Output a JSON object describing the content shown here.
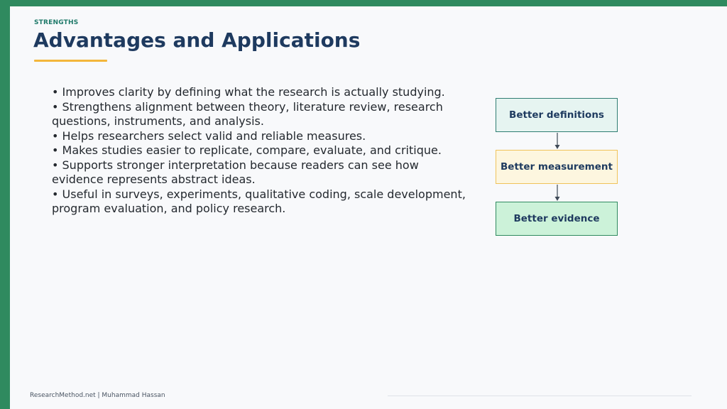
{
  "slide": {
    "eyebrow": "STRENGTHS",
    "title": "Advantages and Applications",
    "bullets": [
      "• Improves clarity by defining what the research is actually studying.",
      "• Strengthens alignment between theory, literature review, research questions, instruments, and analysis.",
      "• Helps researchers select valid and reliable measures.",
      "• Makes studies easier to replicate, compare, evaluate, and critique.",
      "• Supports stronger interpretation because readers can see how evidence represents abstract ideas.",
      "• Useful in surveys, experiments, qualitative coding, scale development, program evaluation, and policy research."
    ]
  },
  "flow": {
    "boxes": [
      "Better definitions",
      "Better measurement",
      "Better evidence"
    ]
  },
  "footer": {
    "text": "ResearchMethod.net | Muhammad Hassan"
  },
  "colors": {
    "accent_green": "#2f8a5f",
    "title_navy": "#1e3a5f",
    "underline_gold": "#f3b63b",
    "eyebrow_teal": "#1f7a6a"
  }
}
